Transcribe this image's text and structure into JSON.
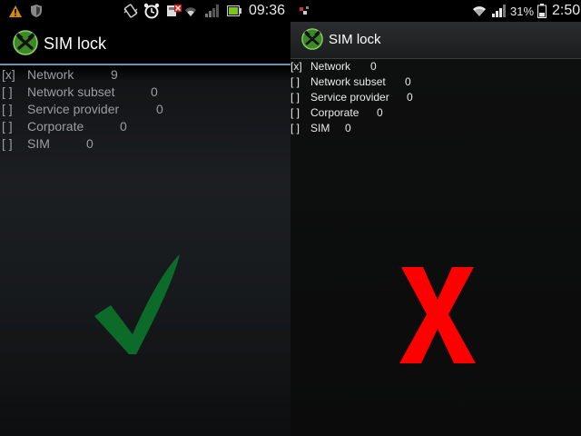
{
  "left": {
    "status": {
      "time": "09:36",
      "icons": [
        "warning-triangle-icon",
        "shield-icon",
        "vibrate-icon",
        "alarm-clock-icon",
        "sim-blocked-icon",
        "wifi-icon",
        "signal-icon",
        "battery-icon"
      ]
    },
    "title": "SIM lock",
    "locks": [
      {
        "flag": "[x]",
        "name": "Network",
        "count": "9"
      },
      {
        "flag": "[ ]",
        "name": "Network subset",
        "count": "0"
      },
      {
        "flag": "[ ]",
        "name": "Service provider",
        "count": "0"
      },
      {
        "flag": "[ ]",
        "name": "Corporate",
        "count": "0"
      },
      {
        "flag": "[ ]",
        "name": "SIM",
        "count": "0"
      }
    ],
    "result_icon": "green-checkmark-icon",
    "result_color": "#0d6b2a"
  },
  "right": {
    "status": {
      "battery_percent": "31%",
      "time": "2:50",
      "icons": [
        "notification-icon",
        "wifi-icon",
        "signal-icon",
        "battery-icon"
      ]
    },
    "title": "SIM lock",
    "locks": [
      {
        "flag": "[x]",
        "name": "Network",
        "count": "0"
      },
      {
        "flag": "[ ]",
        "name": "Network subset",
        "count": "0"
      },
      {
        "flag": "[ ]",
        "name": "Service provider",
        "count": "0"
      },
      {
        "flag": "[ ]",
        "name": "Corporate",
        "count": "0"
      },
      {
        "flag": "[ ]",
        "name": "SIM",
        "count": "0"
      }
    ],
    "result_icon": "red-x-icon",
    "result_color": "#ff0000"
  }
}
